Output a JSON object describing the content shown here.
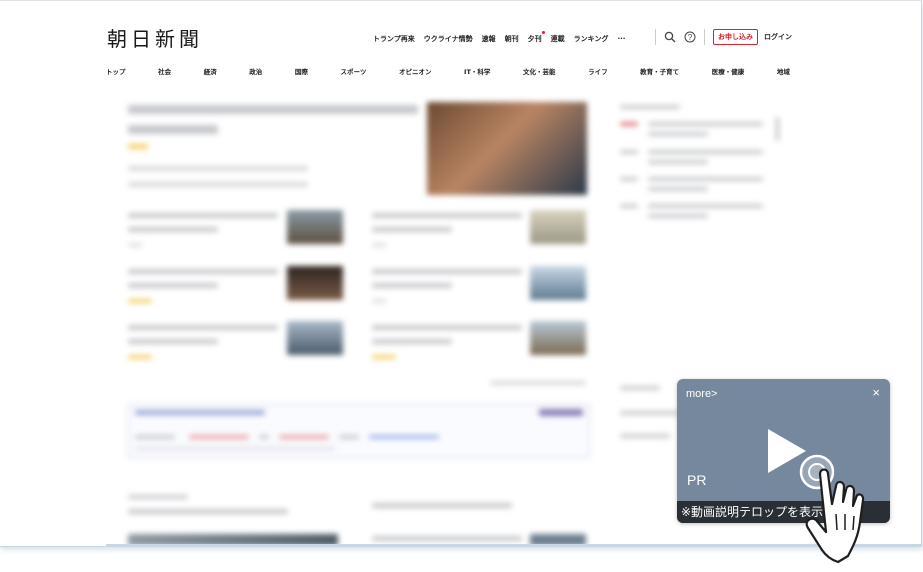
{
  "header": {
    "logo": "朝日新聞",
    "top_nav": [
      "トランプ再来",
      "ウクライナ情勢",
      "速報",
      "朝刊"
    ],
    "top_nav_yukan": "夕刊",
    "top_nav_rest": [
      "連載",
      "ランキング"
    ],
    "more_label": "···",
    "search_icon": "search-icon",
    "help_icon": "help-icon",
    "subscribe_label": "お申し込み",
    "login_label": "ログイン"
  },
  "categories": [
    "トップ",
    "社会",
    "経済",
    "政治",
    "国際",
    "スポーツ",
    "オピニオン",
    "IT・科学",
    "文化・芸能",
    "ライフ",
    "教育・子育て",
    "医療・健康",
    "地域"
  ],
  "video_ad": {
    "more_label": "more>",
    "close_label": "×",
    "pr_label": "PR",
    "caption": "※動画説明テロップを表示します"
  },
  "colors": {
    "accent_red": "#d8252d",
    "video_bg": "#76889d",
    "caption_bg": "#2a2f35"
  }
}
